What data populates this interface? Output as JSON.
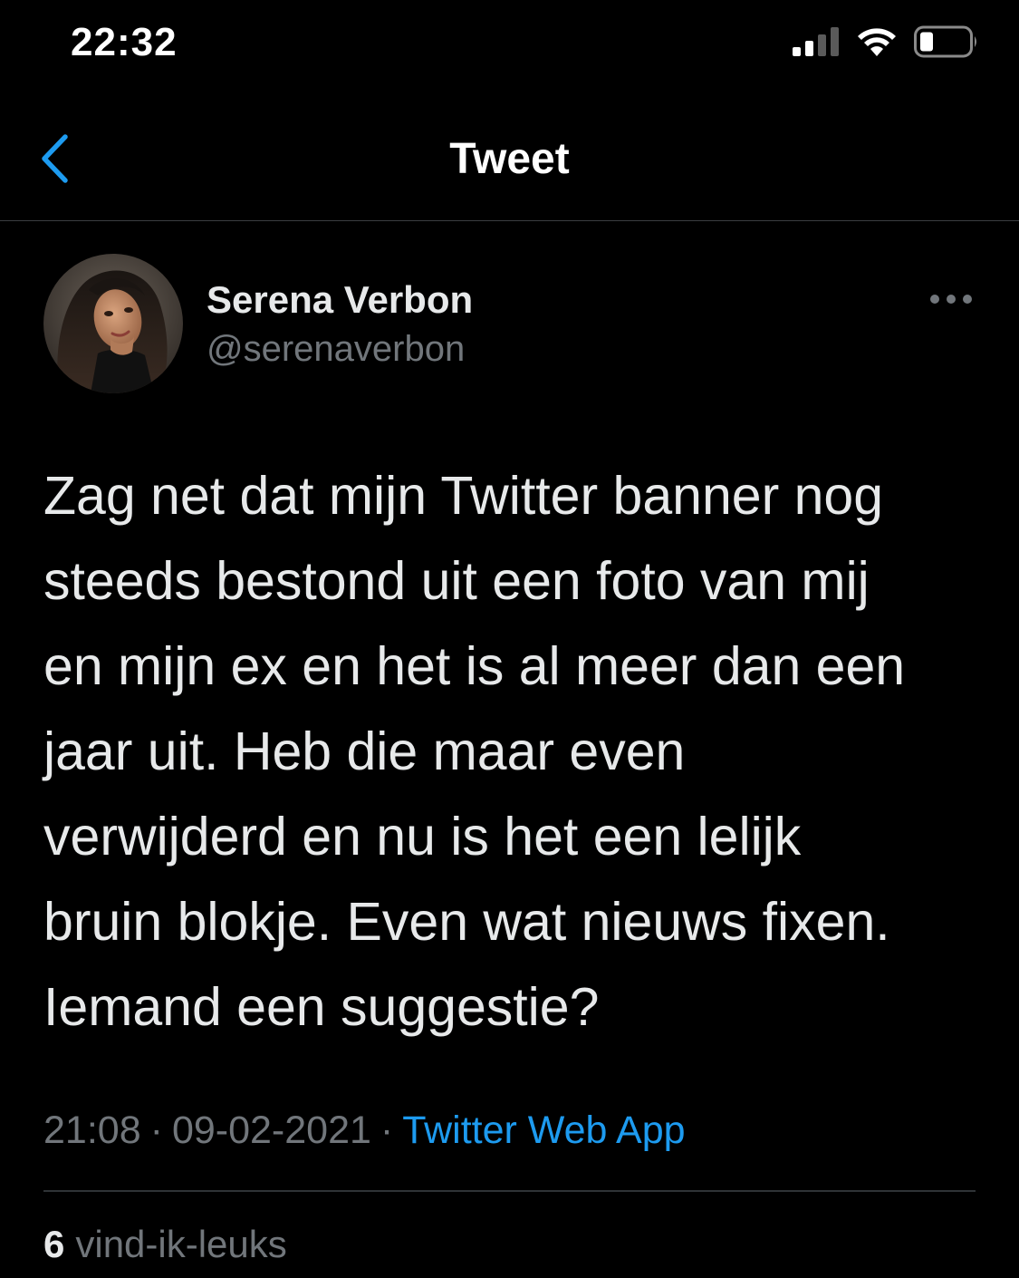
{
  "status_bar": {
    "time": "22:32",
    "icons": [
      "cellular-signal-icon",
      "wifi-icon",
      "battery-icon"
    ]
  },
  "header": {
    "title": "Tweet",
    "back_icon": "chevron-left-icon"
  },
  "tweet": {
    "author_name": "Serena Verbon",
    "author_handle": "@serenaverbon",
    "text": "Zag net dat mijn Twitter banner nog\nsteeds bestond uit een foto van mij\nen mijn ex en het is al meer dan een\njaar uit. Heb die maar even\nverwijderd en nu is het een lelijk\nbruin blokje. Even wat nieuws fixen.\nIemand een suggestie?",
    "time": "21:08",
    "date": "09-02-2021",
    "separator": "·",
    "source": "Twitter Web App",
    "likes_count": "6",
    "likes_label": "vind-ik-leuks"
  },
  "colors": {
    "background": "#000000",
    "accent": "#1d9bf0",
    "primary_text": "#e7e9ea",
    "secondary_text": "#71767b",
    "divider": "#2f3336"
  }
}
